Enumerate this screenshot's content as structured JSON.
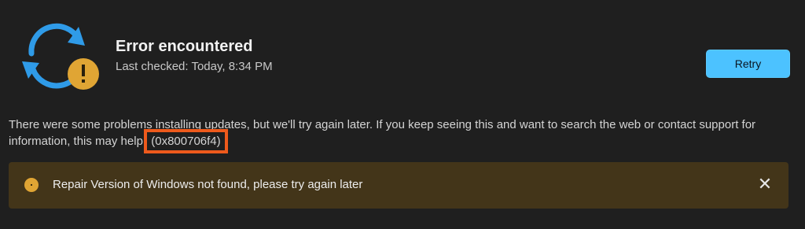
{
  "status": {
    "title": "Error encountered",
    "last_checked": "Last checked: Today, 8:34 PM",
    "icon": "update-sync-icon",
    "badge_icon": "warning-badge-icon"
  },
  "actions": {
    "retry_label": "Retry"
  },
  "message": {
    "text": "There were some problems installing updates, but we'll try again later. If you keep seeing this and want to search the web or contact support for information, this may help:",
    "error_code": "(0x800706f4)"
  },
  "infobar": {
    "text": "Repair Version of Windows not found, please try again later",
    "close_icon": "close-icon"
  },
  "colors": {
    "accent": "#4cc2ff",
    "highlight_box": "#ee5a1c",
    "warning_bar": "#433519",
    "warning_badge": "#e0a534"
  }
}
